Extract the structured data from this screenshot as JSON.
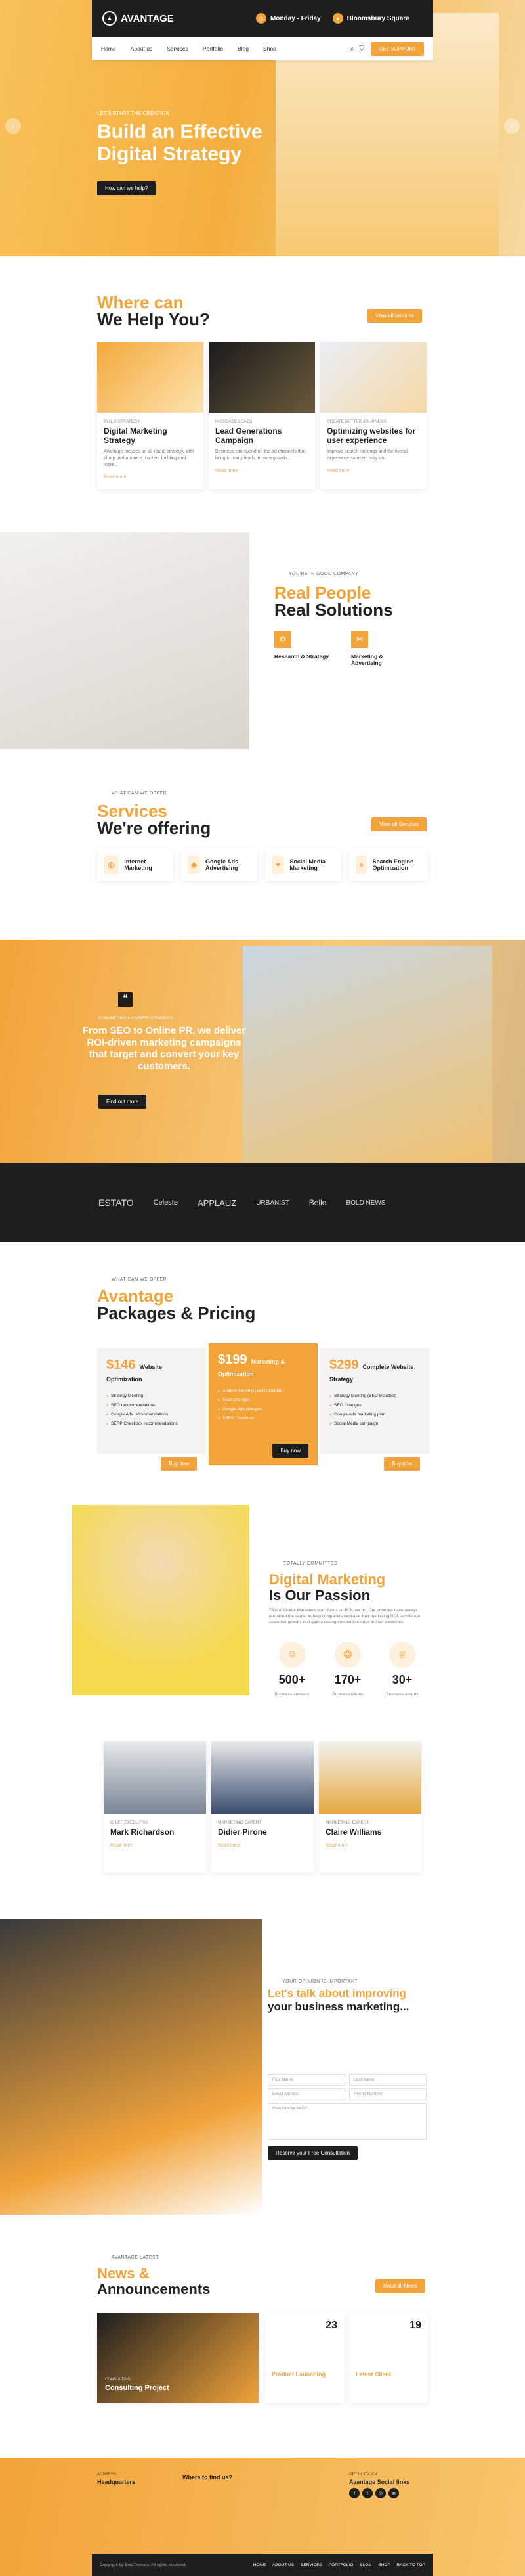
{
  "brand": {
    "name": "AVANTAGE"
  },
  "top": {
    "hours_label": "Monday - Friday",
    "hours": "Monday - Friday",
    "loc_label": "Bloomsbury Square",
    "loc": "Bloomsbury Square",
    "cta": "GET SUPPORT"
  },
  "nav": [
    "Home",
    "About us",
    "Services",
    "Portfolio",
    "Blog",
    "Shop"
  ],
  "hero": {
    "kicker": "LET'S START THE CREATION",
    "title": "Build an Effective Digital Strategy",
    "btn": "How can we help?"
  },
  "help": {
    "title1": "Where can",
    "title2": "We Help You?",
    "btn": "View all services",
    "cards": [
      {
        "k": "BUILD STRATEGY",
        "t": "Digital Marketing Strategy",
        "d": "Avantage focuses on all-round strategy, with sharp performance, content building and more..."
      },
      {
        "k": "INCREASE LEADS",
        "t": "Lead Generations Campaign",
        "d": "Business can spend on the ad channels that bring in many leads, ensure growth..."
      },
      {
        "k": "CREATE BETTER JOURNEYS",
        "t": "Optimizing websites for user experience",
        "d": "Improve search rankings and the overall experience so users stay on..."
      }
    ],
    "read": "Read more"
  },
  "real": {
    "kicker": "YOU'RE IN GOOD COMPANY",
    "t1": "Real People",
    "t2": "Real Solutions",
    "i1": "Research & Strategy",
    "i2": "Marketing & Advertising"
  },
  "services": {
    "kicker": "WHAT CAN WE OFFER",
    "t1": "Services",
    "t2": "We're offering",
    "btn": "View all Services",
    "items": [
      "Internet Marketing",
      "Google Ads Advertising",
      "Social Media Marketing",
      "Search Engine Optimization"
    ]
  },
  "quote": {
    "kicker": "CONSULTING & CAREER STRATEGY",
    "text": "From SEO to Online PR, we deliver ROI-driven marketing campaigns that target and convert your key customers.",
    "btn": "Find out more"
  },
  "logos": [
    "ESTATO",
    "Celeste",
    "APPLAUZ",
    "URBANIST",
    "Bello",
    "BOLD NEWS"
  ],
  "pricing": {
    "kicker": "WHAT CAN WE OFFER",
    "t1": "Avantage",
    "t2": "Packages & Pricing",
    "plans": [
      {
        "p": "$146",
        "n": "Website Optimization",
        "f": [
          "Strategy Meeting",
          "SEO recommendations",
          "Google Ads recommendations",
          "SERP Checkbox recommendations"
        ],
        "btn": "Buy now"
      },
      {
        "p": "$199",
        "n": "Marketing & Optimization",
        "f": [
          "Analytic Meeting (SEO included)",
          "SEO Changes",
          "Google Ads changes",
          "SERP Checkbox"
        ],
        "btn": "Buy now"
      },
      {
        "p": "$299",
        "n": "Complete Website Strategy",
        "f": [
          "Strategy Meeting (SEO included)",
          "SEO Changes",
          "Google Ads marketing plan",
          "Social Media campaign"
        ],
        "btn": "Buy now"
      }
    ]
  },
  "passion": {
    "kicker": "TOTALLY COMMITTED",
    "t1": "Digital Marketing",
    "t2": "Is Our Passion",
    "text": "78% of Online Marketers don't focus on ROI, we do. Our priorities have always remained the same: to help companies increase their marketing ROI, accelerate customer growth, and gain a lasting competitive edge in their industries.",
    "stats": [
      {
        "v": "500+",
        "l": "Business advisors"
      },
      {
        "v": "170+",
        "l": "Business clients"
      },
      {
        "v": "30+",
        "l": "Business awards"
      }
    ]
  },
  "team": [
    {
      "k": "CHIEF EXECUTIVE",
      "n": "Mark Richardson"
    },
    {
      "k": "MARKETING EXPERT",
      "n": "Didier Pirone"
    },
    {
      "k": "MARKETING EXPERT",
      "n": "Claire Williams"
    }
  ],
  "contact": {
    "kicker": "YOUR OPINION IS IMPORTANT",
    "t1": "Let's talk about improving",
    "t2": "your business marketing...",
    "f": [
      "First Name",
      "Last Name",
      "Email Address",
      "Phone Number",
      "How can we help?"
    ],
    "btn": "Reserve your Free Consultation"
  },
  "news": {
    "kicker": "AVANTAGE LATEST",
    "t1": "News &",
    "t2": "Announcements",
    "btn": "Read all News",
    "posts": [
      {
        "k": "CONSULTING",
        "t": "Consulting Project"
      },
      {
        "d": "23",
        "t": "Product Launching"
      },
      {
        "d": "19",
        "t": "Latest Client"
      }
    ]
  },
  "footer": {
    "c1k": "ADDRESS",
    "c1": "Headquarters",
    "c2": "Where to find us?",
    "c3k": "GET IN TOUCH",
    "c3": "Avantage Social links",
    "copy": "Copyright by BoldThemes. All rights reserved.",
    "links": [
      "HOME",
      "ABOUT US",
      "SERVICES",
      "PORTFOLIO",
      "BLOG",
      "SHOP",
      "BACK TO TOP"
    ]
  }
}
